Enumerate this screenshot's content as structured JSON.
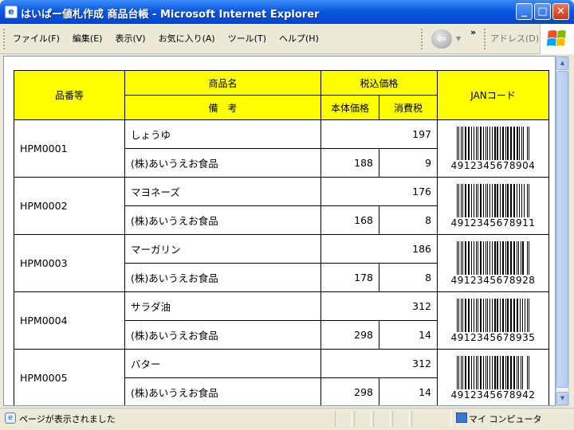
{
  "window": {
    "title": "はいぱー値札作成 商品台帳 - Microsoft Internet Explorer",
    "app_icon": "ie-page-icon"
  },
  "menu": [
    "ファイル(F)",
    "編集(E)",
    "表示(V)",
    "お気に入り(A)",
    "ツール(T)",
    "ヘルプ(H)"
  ],
  "toolbar": {
    "back_icon": "back-arrow-icon",
    "chevron": "»",
    "address_label": "アドレス(D)"
  },
  "table": {
    "headers": {
      "code": "品番等",
      "name": "商品名",
      "price_incl": "税込価格",
      "jan": "JANコード",
      "remarks": "備　考",
      "base_price": "本体価格",
      "tax": "消費税"
    },
    "rows": [
      {
        "code": "HPM0001",
        "name": "しょうゆ",
        "total": "197",
        "remark": "(株)あいうえお食品",
        "base": "188",
        "tax": "9",
        "jan": "4912345678904"
      },
      {
        "code": "HPM0002",
        "name": "マヨネーズ",
        "total": "176",
        "remark": "(株)あいうえお食品",
        "base": "168",
        "tax": "8",
        "jan": "4912345678911"
      },
      {
        "code": "HPM0003",
        "name": "マーガリン",
        "total": "186",
        "remark": "(株)あいうえお食品",
        "base": "178",
        "tax": "8",
        "jan": "4912345678928"
      },
      {
        "code": "HPM0004",
        "name": "サラダ油",
        "total": "312",
        "remark": "(株)あいうえお食品",
        "base": "298",
        "tax": "14",
        "jan": "4912345678935"
      },
      {
        "code": "HPM0005",
        "name": "バター",
        "total": "312",
        "remark": "(株)あいうえお食品",
        "base": "298",
        "tax": "14",
        "jan": "4912345678942"
      }
    ]
  },
  "status": {
    "text": "ページが表示されました",
    "zone": "マイ コンピュータ"
  }
}
